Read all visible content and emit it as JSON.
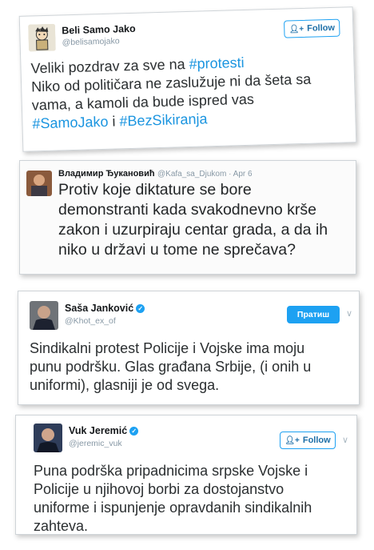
{
  "tweets": [
    {
      "name": "Beli Samo Jako",
      "handle": "@belisamojako",
      "follow_label": "Follow",
      "lines": [
        [
          {
            "t": "Veliki pozdrav za sve na "
          },
          {
            "t": "#protesti",
            "h": true
          }
        ],
        [
          {
            "t": "Niko od političara ne zaslužuje ni da šeta sa"
          }
        ],
        [
          {
            "t": "vama, a kamoli da bude ispred vas"
          }
        ],
        [
          {
            "t": "#SamoJako",
            "h": true
          },
          {
            "t": " i "
          },
          {
            "t": "#BezSikiranja",
            "h": true
          }
        ]
      ]
    },
    {
      "name": "Владимир Ђукановић",
      "handle": "@Kafa_sa_Djukom",
      "date": "Apr 6",
      "lines": [
        [
          {
            "t": "Protiv koje diktature se bore"
          }
        ],
        [
          {
            "t": "demonstranti kada svakodnevno krše"
          }
        ],
        [
          {
            "t": "zakon i uzurpiraju centar grada, a da ih"
          }
        ],
        [
          {
            "t": "niko u državi u tome ne sprečava?"
          }
        ]
      ]
    },
    {
      "name": "Saša Janković",
      "handle": "@Khot_ex_of",
      "following_label": "Пратиш",
      "lines": [
        [
          {
            "t": "Sindikalni protest Policije i Vojske ima moju"
          }
        ],
        [
          {
            "t": "punu podršku. Glas građana Srbije, (i onih u"
          }
        ],
        [
          {
            "t": "uniformi), glasniji je od svega."
          }
        ]
      ]
    },
    {
      "name": "Vuk Jeremić",
      "handle": "@jeremic_vuk",
      "follow_label": "Follow",
      "lines": [
        [
          {
            "t": "Puna podrška pripadnicima srpske Vojske i"
          }
        ],
        [
          {
            "t": "Policije u njihovoj borbi za dostojanstvo"
          }
        ],
        [
          {
            "t": "uniforme i ispunjenje opravdanih sindikalnih"
          }
        ],
        [
          {
            "t": "zahteva."
          }
        ]
      ]
    }
  ],
  "colors": {
    "hashtag": "#1b95e0",
    "accent": "#1da1f2",
    "handle": "#8899a6"
  },
  "icons": [
    "follow-person-icon",
    "verified-badge-icon",
    "chevron-down-icon",
    "avatar"
  ]
}
